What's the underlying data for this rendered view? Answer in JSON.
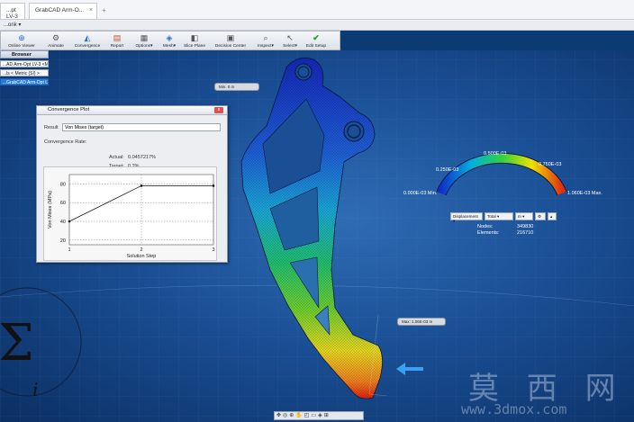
{
  "titlebar": {
    "doc_tab_left": "...pt LV-3",
    "doc_tab": "GrabCAD Arm-O...",
    "address_fragment": "...onk ▾"
  },
  "ribbon": {
    "buttons": [
      {
        "label": "Online Viewer",
        "icon": "globe-icon"
      },
      {
        "label": "Animate",
        "icon": "animate-icon"
      },
      {
        "label": "Convergence",
        "icon": "convergence-icon"
      },
      {
        "label": "Report",
        "icon": "report-icon"
      },
      {
        "label": "Options",
        "icon": "options-icon"
      },
      {
        "label": "Mesh",
        "icon": "mesh-icon"
      },
      {
        "label": "Slice Plane",
        "icon": "slice-plane-icon"
      },
      {
        "label": "Decision Center",
        "icon": "decision-center-icon"
      },
      {
        "label": "Inspect",
        "icon": "inspect-icon"
      },
      {
        "label": "Select",
        "icon": "select-icon"
      },
      {
        "label": "Edit Setup",
        "icon": "edit-setup-icon"
      }
    ]
  },
  "browser": {
    "title": "Browser",
    "nodes": [
      "...AD Arm-Opt LV-3 <M",
      "...ls < Metric (SI) >",
      "...GrabCAD Arm-Opt LV-3"
    ]
  },
  "convergence": {
    "title": "Convergence Plot",
    "close_label": "x",
    "result_label": "Result",
    "result_value": "Von Mises (target)",
    "rate_label": "Convergence Rate:",
    "actual_label": "Actual:",
    "actual_value": "0.0457217%",
    "target_label": "Target:",
    "target_value": "0.2%"
  },
  "chart_data": {
    "type": "line",
    "x": [
      1,
      2,
      3
    ],
    "series": [
      {
        "values": [
          40,
          78,
          78
        ]
      }
    ],
    "xlabel": "Solution Step",
    "ylabel": "Von Mises (MPa)",
    "yticks": [
      20,
      40,
      60,
      80
    ],
    "xticks": [
      1,
      2,
      3
    ],
    "ylim": [
      15,
      90
    ],
    "xlim": [
      1,
      3
    ],
    "grid": true
  },
  "legend": {
    "labels": [
      "0.000E-03 Min.",
      "0.250E-03",
      "0.500E-03",
      "0.750E-03",
      "1.060E-03 Max."
    ],
    "colors": [
      "#1030c8",
      "#00b0e0",
      "#30d040",
      "#f0e000",
      "#e03010"
    ],
    "result_select": "Displacement",
    "component_select": "Total",
    "units_select": "m",
    "nodes_label": "Nodes:",
    "nodes_value": "349830",
    "elements_label": "Elements:",
    "elements_value": "216710"
  },
  "callouts": {
    "min": "Min. 0 m",
    "max": "Max: 1.06E-03 m"
  },
  "navbar": {
    "glyphs": "✥◎⊕✋◰▭◈⊞"
  },
  "watermark": {
    "cn": "莫 西 网",
    "url": "www.3dmox.com"
  }
}
